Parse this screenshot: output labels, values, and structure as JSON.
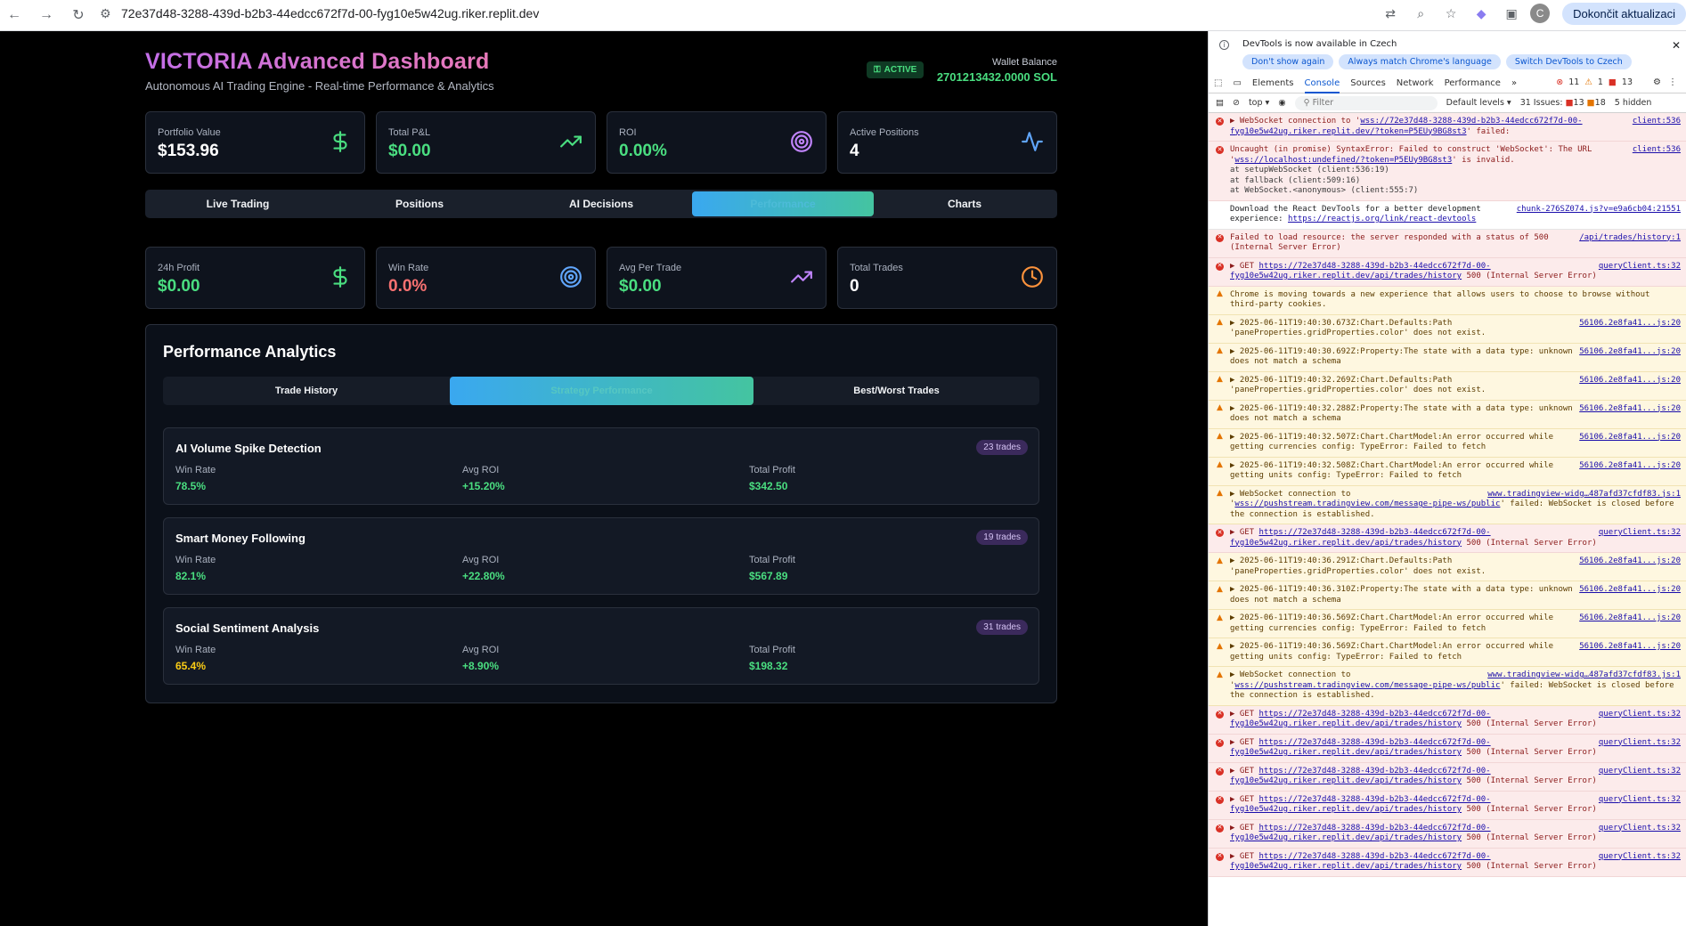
{
  "browser": {
    "url": "72e37d48-3288-439d-b2b3-44edcc672f7d-00-fyg10e5w42ug.riker.replit.dev",
    "update_button": "Dokončit aktualizaci",
    "avatar_letter": "C"
  },
  "header": {
    "title": "VICTORIA Advanced Dashboard",
    "subtitle": "Autonomous AI Trading Engine - Real-time Performance & Analytics",
    "status": "ACTIVE",
    "wallet_label": "Wallet Balance",
    "wallet_value": "2701213432.0000 SOL"
  },
  "top_cards": [
    {
      "label": "Portfolio Value",
      "value": "$153.96",
      "icon": "dollar-icon",
      "color": "#ffffff",
      "icon_color": "#4ade80"
    },
    {
      "label": "Total P&L",
      "value": "$0.00",
      "icon": "trending-up-icon",
      "color": "#4ade80",
      "icon_color": "#4ade80"
    },
    {
      "label": "ROI",
      "value": "0.00%",
      "icon": "target-icon",
      "color": "#4ade80",
      "icon_color": "#c084fc"
    },
    {
      "label": "Active Positions",
      "value": "4",
      "icon": "activity-icon",
      "color": "#ffffff",
      "icon_color": "#60a5fa"
    }
  ],
  "tabs": [
    "Live Trading",
    "Positions",
    "AI Decisions",
    "Performance",
    "Charts"
  ],
  "active_tab": 3,
  "perf_cards": [
    {
      "label": "24h Profit",
      "value": "$0.00",
      "icon": "dollar-icon",
      "color": "#4ade80",
      "icon_color": "#4ade80"
    },
    {
      "label": "Win Rate",
      "value": "0.0%",
      "icon": "target-icon",
      "color": "#f87171",
      "icon_color": "#60a5fa"
    },
    {
      "label": "Avg Per Trade",
      "value": "$0.00",
      "icon": "trending-up-icon",
      "color": "#4ade80",
      "icon_color": "#c084fc"
    },
    {
      "label": "Total Trades",
      "value": "0",
      "icon": "clock-icon",
      "color": "#ffffff",
      "icon_color": "#fb923c"
    }
  ],
  "analytics": {
    "title": "Performance Analytics",
    "subtabs": [
      "Trade History",
      "Strategy Performance",
      "Best/Worst Trades"
    ],
    "active_subtab": 1,
    "metric_labels": [
      "Win Rate",
      "Avg ROI",
      "Total Profit"
    ],
    "strategies": [
      {
        "name": "AI Volume Spike Detection",
        "trades": "23 trades",
        "win_rate": "78.5%",
        "avg_roi": "+15.20%",
        "total_profit": "$342.50",
        "win_color": "#4ade80"
      },
      {
        "name": "Smart Money Following",
        "trades": "19 trades",
        "win_rate": "82.1%",
        "avg_roi": "+22.80%",
        "total_profit": "$567.89",
        "win_color": "#4ade80"
      },
      {
        "name": "Social Sentiment Analysis",
        "trades": "31 trades",
        "win_rate": "65.4%",
        "avg_roi": "+8.90%",
        "total_profit": "$198.32",
        "win_color": "#facc15"
      }
    ]
  },
  "devtools": {
    "info_message": "DevTools is now available in Czech",
    "info_buttons": [
      "Don't show again",
      "Always match Chrome's language",
      "Switch DevTools to Czech"
    ],
    "tabs": [
      "Elements",
      "Console",
      "Sources",
      "Network",
      "Performance"
    ],
    "active_tab": 1,
    "counts": {
      "errors": "11",
      "warnings": "1",
      "issues": "13"
    },
    "context": "top",
    "filter_placeholder": "Filter",
    "levels": "Default levels",
    "issues_label": "31 Issues:",
    "issues_err": "13",
    "issues_warn": "18",
    "hidden": "5 hidden",
    "entries": [
      {
        "type": "err",
        "text": "▶ WebSocket connection to '",
        "link": "wss://72e37d48-3288-439d-b2b3-44edcc672f7d-00-fyg10e5w42ug.riker.replit.dev/?token=P5EUy9BG8st3",
        "tail": "' failed:",
        "src": "client:536"
      },
      {
        "type": "err",
        "text": "Uncaught (in promise) SyntaxError: Failed to construct 'WebSocket': The URL '",
        "link": "wss://localhost:undefined/?token=P5EUy9BG8st3",
        "tail": "' is invalid.",
        "extra": [
          "    at setupWebSocket (client:536:19)",
          "    at fallback (client:509:16)",
          "    at WebSocket.<anonymous> (client:555:7)"
        ],
        "src": "client:536"
      },
      {
        "type": "plain",
        "text": "Download the React DevTools for a better development experience: ",
        "link": "https://reactjs.org/link/react-devtools",
        "tail": "",
        "src": "chunk-276SZ074.js?v=e9a6cb04:21551"
      },
      {
        "type": "err",
        "text": "Failed to load resource: the server responded with a status of 500 (Internal Server Error)",
        "link": "",
        "tail": "",
        "src": "/api/trades/history:1"
      },
      {
        "type": "err",
        "text": "▶ GET ",
        "link": "https://72e37d48-3288-439d-b2b3-44edcc672f7d-00-fyg10e5w42ug.riker.replit.dev/api/trades/history",
        "tail": " 500 (Internal Server Error)",
        "src": "queryClient.ts:32"
      },
      {
        "type": "warn",
        "text": "Chrome is moving towards a new experience that allows users to choose to browse without third-party cookies.",
        "link": "",
        "tail": "",
        "src": ""
      },
      {
        "type": "warn",
        "text": "▶ 2025-06-11T19:40:30.673Z:Chart.Defaults:Path 'paneProperties.gridProperties.color' does not exist.",
        "link": "",
        "tail": "",
        "src": "56106.2e8fa41...js:20"
      },
      {
        "type": "warn",
        "text": "▶ 2025-06-11T19:40:30.692Z:Property:The state with a data type: unknown does not match a schema",
        "link": "",
        "tail": "",
        "src": "56106.2e8fa41...js:20"
      },
      {
        "type": "warn",
        "text": "▶ 2025-06-11T19:40:32.269Z:Chart.Defaults:Path 'paneProperties.gridProperties.color' does not exist.",
        "link": "",
        "tail": "",
        "src": "56106.2e8fa41...js:20"
      },
      {
        "type": "warn",
        "text": "▶ 2025-06-11T19:40:32.288Z:Property:The state with a data type: unknown does not match a schema",
        "link": "",
        "tail": "",
        "src": "56106.2e8fa41...js:20"
      },
      {
        "type": "warn",
        "text": "▶ 2025-06-11T19:40:32.507Z:Chart.ChartModel:An error occurred while getting currencies config: TypeError: Failed to fetch",
        "link": "",
        "tail": "",
        "src": "56106.2e8fa41...js:20"
      },
      {
        "type": "warn",
        "text": "▶ 2025-06-11T19:40:32.508Z:Chart.ChartModel:An error occurred while getting units config: TypeError: Failed to fetch",
        "link": "",
        "tail": "",
        "src": "56106.2e8fa41...js:20"
      },
      {
        "type": "warn",
        "text": "▶ WebSocket connection to '",
        "link": "wss://pushstream.tradingview.com/message-pipe-ws/public",
        "tail": "' failed: WebSocket is closed before the connection is established.",
        "src": "www.tradingview-widg…487afd37cfdf83.js:1"
      },
      {
        "type": "err",
        "text": "▶ GET ",
        "link": "https://72e37d48-3288-439d-b2b3-44edcc672f7d-00-fyg10e5w42ug.riker.replit.dev/api/trades/history",
        "tail": " 500 (Internal Server Error)",
        "src": "queryClient.ts:32"
      },
      {
        "type": "warn",
        "text": "▶ 2025-06-11T19:40:36.291Z:Chart.Defaults:Path 'paneProperties.gridProperties.color' does not exist.",
        "link": "",
        "tail": "",
        "src": "56106.2e8fa41...js:20"
      },
      {
        "type": "warn",
        "text": "▶ 2025-06-11T19:40:36.310Z:Property:The state with a data type: unknown does not match a schema",
        "link": "",
        "tail": "",
        "src": "56106.2e8fa41...js:20"
      },
      {
        "type": "warn",
        "text": "▶ 2025-06-11T19:40:36.569Z:Chart.ChartModel:An error occurred while getting currencies config: TypeError: Failed to fetch",
        "link": "",
        "tail": "",
        "src": "56106.2e8fa41...js:20"
      },
      {
        "type": "warn",
        "text": "▶ 2025-06-11T19:40:36.569Z:Chart.ChartModel:An error occurred while getting units config: TypeError: Failed to fetch",
        "link": "",
        "tail": "",
        "src": "56106.2e8fa41...js:20"
      },
      {
        "type": "warn",
        "text": "▶ WebSocket connection to '",
        "link": "wss://pushstream.tradingview.com/message-pipe-ws/public",
        "tail": "' failed: WebSocket is closed before the connection is established.",
        "src": "www.tradingview-widg…487afd37cfdf83.js:1"
      },
      {
        "type": "err",
        "text": "▶ GET ",
        "link": "https://72e37d48-3288-439d-b2b3-44edcc672f7d-00-fyg10e5w42ug.riker.replit.dev/api/trades/history",
        "tail": " 500 (Internal Server Error)",
        "src": "queryClient.ts:32"
      },
      {
        "type": "err",
        "text": "▶ GET ",
        "link": "https://72e37d48-3288-439d-b2b3-44edcc672f7d-00-fyg10e5w42ug.riker.replit.dev/api/trades/history",
        "tail": " 500 (Internal Server Error)",
        "src": "queryClient.ts:32"
      },
      {
        "type": "err",
        "text": "▶ GET ",
        "link": "https://72e37d48-3288-439d-b2b3-44edcc672f7d-00-fyg10e5w42ug.riker.replit.dev/api/trades/history",
        "tail": " 500 (Internal Server Error)",
        "src": "queryClient.ts:32"
      },
      {
        "type": "err",
        "text": "▶ GET ",
        "link": "https://72e37d48-3288-439d-b2b3-44edcc672f7d-00-fyg10e5w42ug.riker.replit.dev/api/trades/history",
        "tail": " 500 (Internal Server Error)",
        "src": "queryClient.ts:32"
      },
      {
        "type": "err",
        "text": "▶ GET ",
        "link": "https://72e37d48-3288-439d-b2b3-44edcc672f7d-00-fyg10e5w42ug.riker.replit.dev/api/trades/history",
        "tail": " 500 (Internal Server Error)",
        "src": "queryClient.ts:32"
      },
      {
        "type": "err",
        "text": "▶ GET ",
        "link": "https://72e37d48-3288-439d-b2b3-44edcc672f7d-00-fyg10e5w42ug.riker.replit.dev/api/trades/history",
        "tail": " 500 (Internal Server Error)",
        "src": "queryClient.ts:32"
      }
    ]
  }
}
